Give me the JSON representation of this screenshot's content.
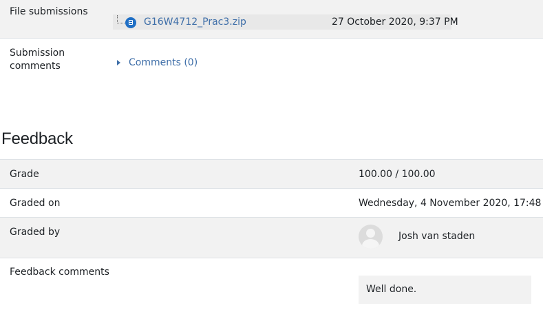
{
  "submission": {
    "file_label": "File submissions",
    "file_name": "G16W4712_Prac3.zip",
    "file_date": "27 October 2020, 9:37 PM",
    "comments_label_line1": "Submission",
    "comments_label_line2": "comments",
    "comments_link": "Comments (0)"
  },
  "feedback": {
    "heading": "Feedback",
    "grade_label": "Grade",
    "grade_value": "100.00 / 100.00",
    "graded_on_label": "Graded on",
    "graded_on_value": "Wednesday, 4 November 2020, 17:48",
    "graded_by_label": "Graded by",
    "grader_name": "Josh van staden",
    "comments_label": "Feedback comments",
    "comments_text": "Well done."
  },
  "colors": {
    "link": "#3e6ea8",
    "shade": "#f2f2f2",
    "file_icon": "#1f6fc5"
  }
}
